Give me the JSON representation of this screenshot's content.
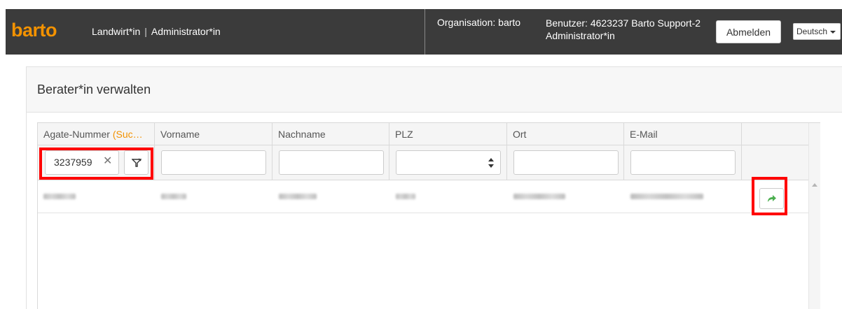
{
  "header": {
    "logo": "barto",
    "role_primary": "Landwirt*in",
    "role_separator": "|",
    "role_secondary": "Administrator*in",
    "organisation": "Organisation: barto",
    "user_line1": "Benutzer: 4623237 Barto Support-2",
    "user_line2": "Administrator*in",
    "logout_label": "Abmelden",
    "language": "Deutsch"
  },
  "panel": {
    "title": "Berater*in verwalten"
  },
  "grid": {
    "columns": [
      {
        "label": "Agate-Nummer ",
        "sublabel": "(Suc…"
      },
      {
        "label": "Vorname"
      },
      {
        "label": "Nachname"
      },
      {
        "label": "PLZ"
      },
      {
        "label": "Ort"
      },
      {
        "label": "E-Mail"
      },
      {
        "label": ""
      }
    ],
    "filters": {
      "agate_value": "3237959",
      "vorname": "",
      "nachname": "",
      "plz": "",
      "ort": "",
      "email": ""
    },
    "rows_redacted": 1
  },
  "icons": {
    "clear": "close-icon",
    "filter_remove": "filter-remove-icon",
    "open": "share-arrow-icon",
    "spinner": "number-spinner-icon"
  },
  "colors": {
    "topbar": "#3b3b3b",
    "brand": "#f39200",
    "highlight": "#ff0000",
    "open_arrow": "#4caf50"
  }
}
